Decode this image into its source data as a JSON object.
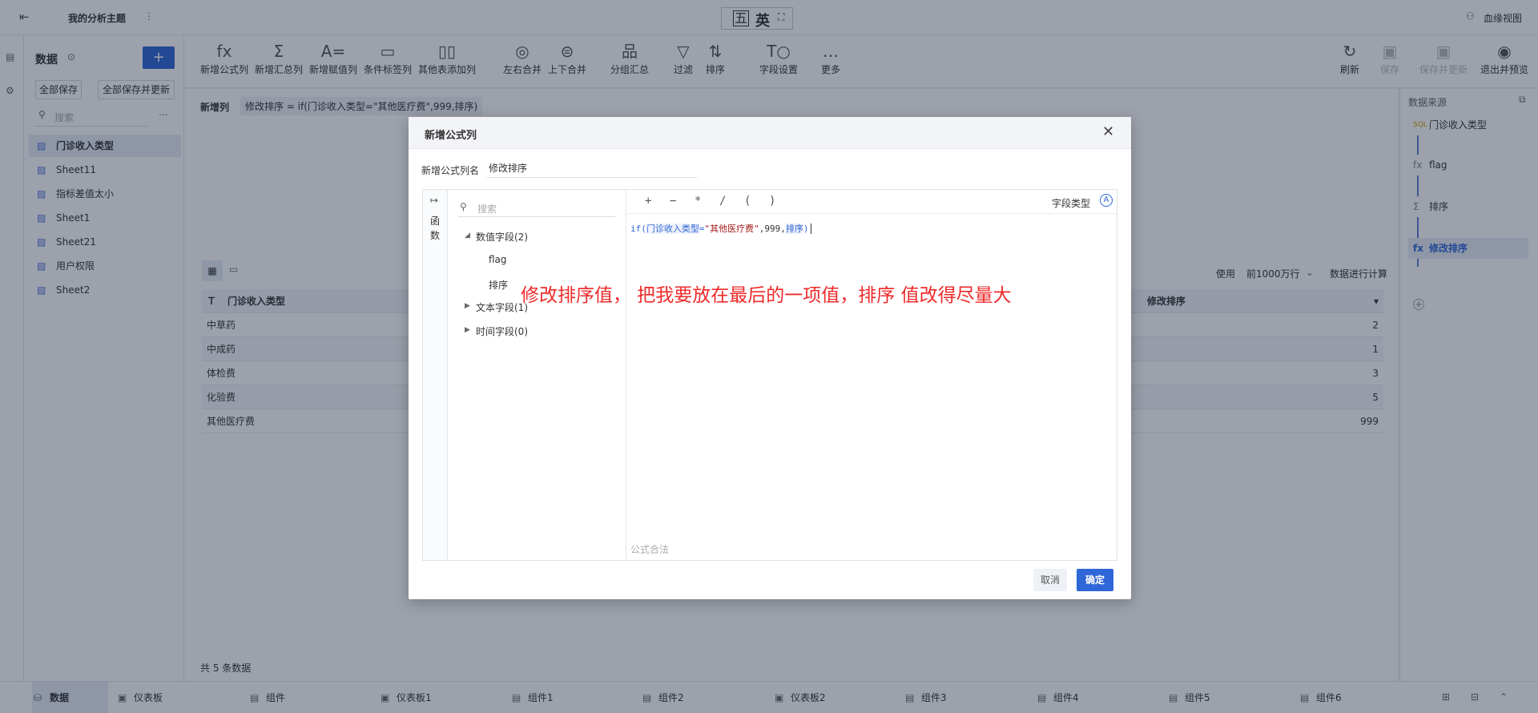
{
  "topbar": {
    "back_icon": "exit-icon",
    "title": "我的分析主题",
    "more_icon": "vertical-dots-icon",
    "ime": {
      "a": "五",
      "b": "英"
    },
    "lineage_label": "血缘视图"
  },
  "sidebar": {
    "title": "数据",
    "add_label": "+",
    "save_all": "全部保存",
    "save_all_update": "全部保存并更新",
    "search_placeholder": "搜索",
    "items": [
      {
        "label": "门诊收入类型"
      },
      {
        "label": "Sheet11"
      },
      {
        "label": "指标差值太小"
      },
      {
        "label": "Sheet1"
      },
      {
        "label": "Sheet21"
      },
      {
        "label": "用户权限"
      },
      {
        "label": "Sheet2"
      }
    ]
  },
  "toolbar": {
    "items": [
      {
        "label": "新增公式列",
        "icon": "fx"
      },
      {
        "label": "新增汇总列",
        "icon": "Σ"
      },
      {
        "label": "新增赋值列",
        "icon": "A="
      },
      {
        "label": "条件标签列",
        "icon": "▭"
      },
      {
        "label": "其他表添加列",
        "icon": "▯▯"
      },
      {
        "label": "左右合并",
        "icon": "◎"
      },
      {
        "label": "上下合并",
        "icon": "⊜"
      },
      {
        "label": "分组汇总",
        "icon": "品"
      },
      {
        "label": "过滤",
        "icon": "▽"
      },
      {
        "label": "排序",
        "icon": "⇅"
      },
      {
        "label": "字段设置",
        "icon": "T○"
      },
      {
        "label": "更多",
        "icon": "…"
      }
    ],
    "right": [
      {
        "label": "刷新",
        "icon": "↻"
      },
      {
        "label": "保存",
        "icon": "▣"
      },
      {
        "label": "保存并更新",
        "icon": "▣"
      },
      {
        "label": "退出并预览",
        "icon": "◉"
      }
    ]
  },
  "formulabar": {
    "label": "新增列",
    "formula": "修改排序 = if(门诊收入类型=\"其他医疗费\",999,排序)"
  },
  "preview": {
    "use_label": "使用",
    "rows_select": "前1000万行",
    "calc_label": "数据进行计算",
    "col1": "门诊收入类型",
    "col2": "修改排序",
    "rows": [
      {
        "a": "中草药",
        "b": "2"
      },
      {
        "a": "中成药",
        "b": "1"
      },
      {
        "a": "体检费",
        "b": "3"
      },
      {
        "a": "化验费",
        "b": "5"
      },
      {
        "a": "其他医疗费",
        "b": "999"
      }
    ],
    "footer": "共 5 条数据"
  },
  "rightpanel": {
    "title": "数据来源",
    "nodes": [
      {
        "label": "门诊收入类型",
        "icon": "SQL"
      },
      {
        "label": "flag",
        "icon": "fx"
      },
      {
        "label": "排序",
        "icon": "Σ"
      },
      {
        "label": "修改排序",
        "icon": "fx"
      }
    ],
    "add": "+"
  },
  "bottombar": {
    "tabs": [
      {
        "label": "数据"
      },
      {
        "label": "仪表板"
      },
      {
        "label": "组件"
      },
      {
        "label": "仪表板1"
      },
      {
        "label": "组件1"
      },
      {
        "label": "组件2"
      },
      {
        "label": "仪表板2"
      },
      {
        "label": "组件3"
      },
      {
        "label": "组件4"
      },
      {
        "label": "组件5"
      },
      {
        "label": "组件6"
      }
    ]
  },
  "dialog": {
    "title": "新增公式列",
    "name_label": "新增公式列名",
    "name_value": "修改排序",
    "fn_tab": "函数",
    "search_placeholder": "搜索",
    "tree": {
      "numeric": "数值字段(2)",
      "flag": "flag",
      "sort": "排序",
      "text": "文本字段(1)",
      "time": "时间字段(0)"
    },
    "ops": [
      "+",
      "−",
      "*",
      "/",
      "(",
      ")"
    ],
    "field_type_label": "字段类型",
    "formula": {
      "p1": "if(",
      "f1": "门诊收入类型",
      "p2": "=",
      "s1": "\"其他医疗费\"",
      "p3": ",999,",
      "f2": "排序",
      "p4": ")"
    },
    "status": "公式合法",
    "annotation": "修改排序值， 把我要放在最后的一项值，排序 值改得尽量大",
    "cancel": "取消",
    "ok": "确定"
  }
}
